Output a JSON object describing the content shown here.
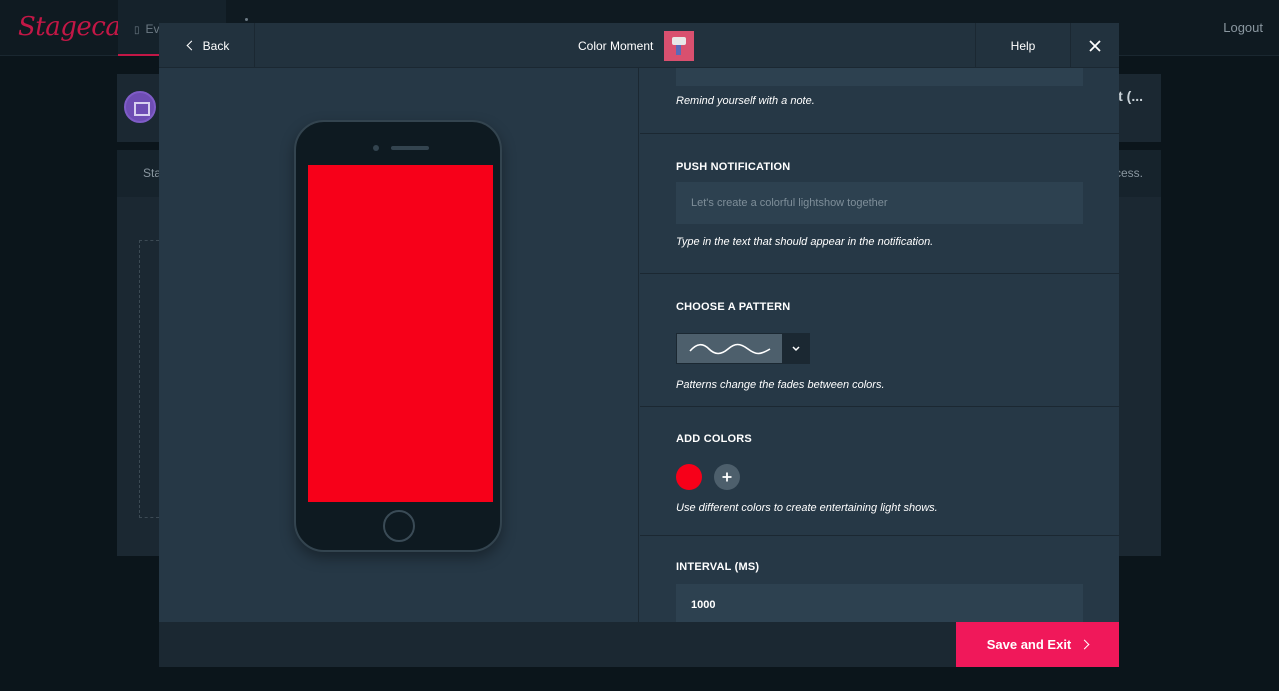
{
  "app": {
    "logo": "Stagecast",
    "active_tab": "Ev",
    "logout": "Logout",
    "card_right": "nt (...",
    "card_left": "Sta",
    "card2_right": "cess."
  },
  "modal": {
    "back_label": "Back",
    "title": "Color Moment",
    "help_label": "Help"
  },
  "settings": {
    "note_hint": "Remind yourself with a note.",
    "push": {
      "title": "PUSH NOTIFICATION",
      "placeholder": "Let's create a colorful lightshow together",
      "value": "",
      "hint": "Type in the text that should appear in the notification."
    },
    "pattern": {
      "title": "CHOOSE A PATTERN",
      "selected": "wave",
      "hint": "Patterns change the fades between colors."
    },
    "colors": {
      "title": "ADD COLORS",
      "items": [
        "#f70019"
      ],
      "hint": "Use different colors to create entertaining light shows."
    },
    "interval": {
      "title": "INTERVAL (MS)",
      "value": "1000"
    }
  },
  "preview": {
    "screen_color": "#f70019"
  },
  "footer": {
    "save_label": "Save and Exit"
  },
  "colors": {
    "accent": "#f0185a",
    "modal_bg": "#263846",
    "panel_dark": "#1b2832"
  }
}
